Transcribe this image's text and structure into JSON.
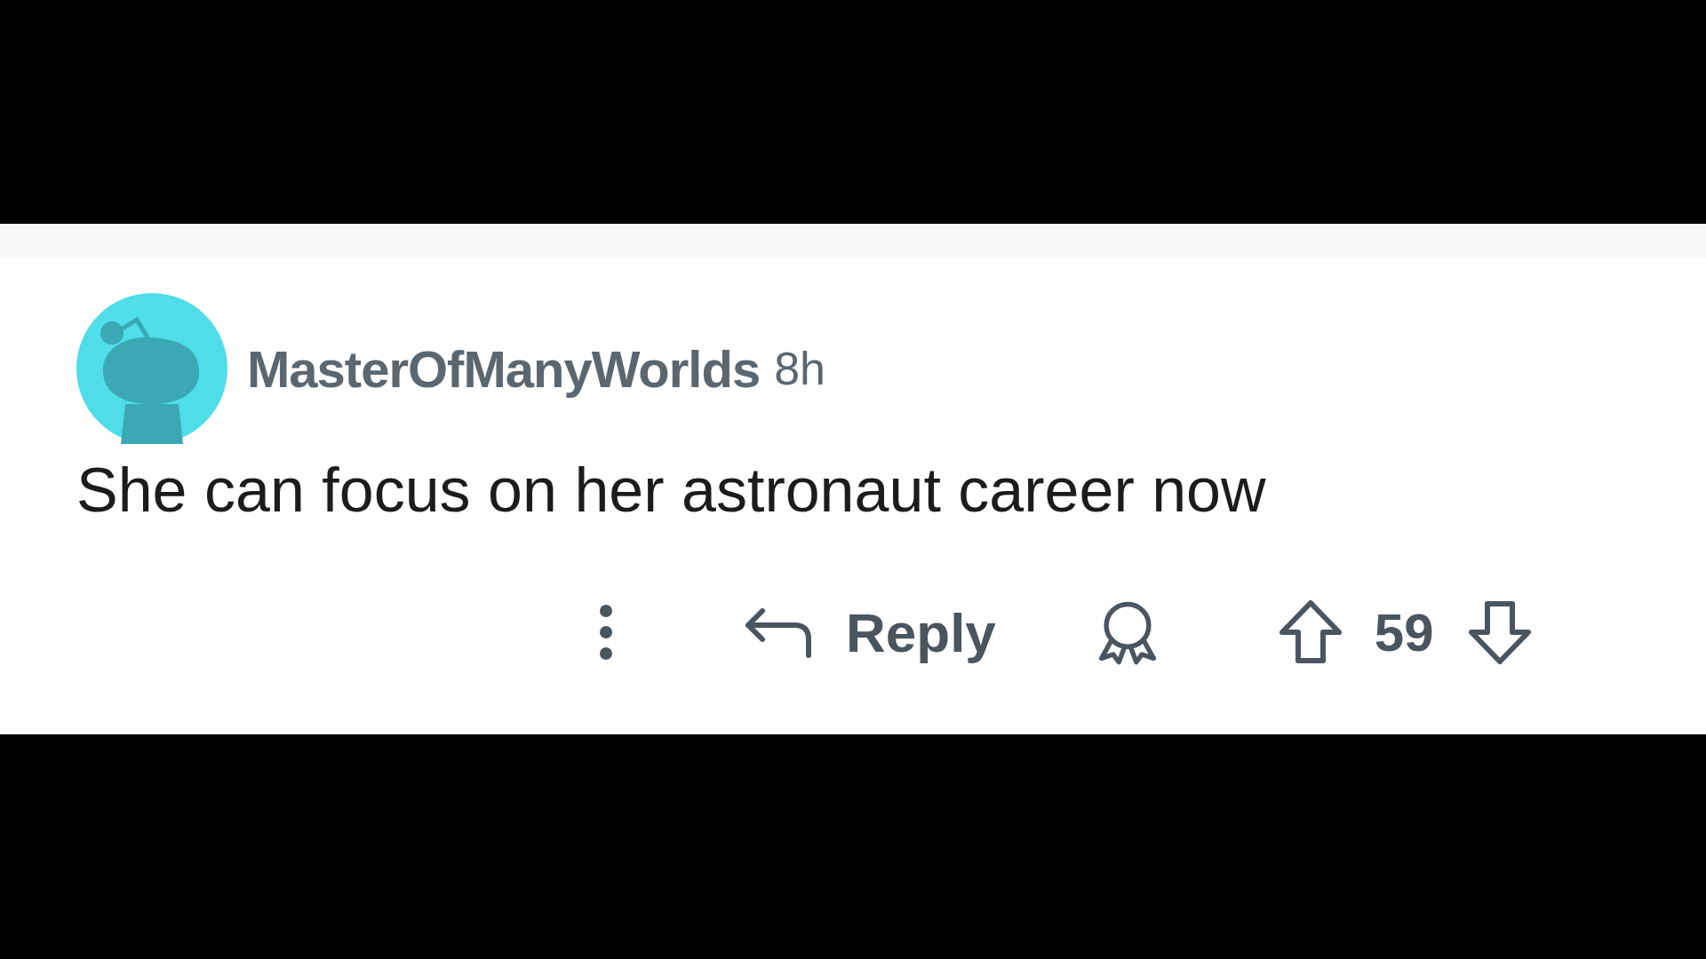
{
  "comment": {
    "author": "MasterOfManyWorlds",
    "time": "8h",
    "body": "She can focus on her astronaut career now"
  },
  "actions": {
    "reply_label": "Reply",
    "score": "59"
  }
}
